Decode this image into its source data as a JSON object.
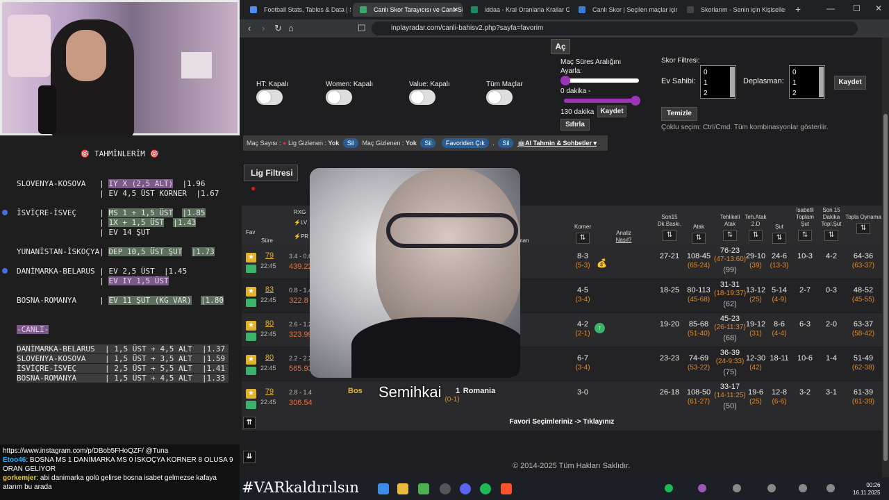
{
  "tabs": [
    {
      "label": "Football Stats, Tables & Data | Socc"
    },
    {
      "label": "Canlı Skor Tarayıcısı ve Canlı Si"
    },
    {
      "label": "iddaa - Kral Oranlarla Krallar Gibi K"
    },
    {
      "label": "Canlı Skor | Seçilen maçlar için canl"
    },
    {
      "label": "Skorlarım - Senin için Kişiselleştirilm"
    }
  ],
  "url": "inplayradar.com/canli-bahisv2.php?sayfa=favorim",
  "predictions": {
    "title": "TAHMİNLERİM",
    "lines": [
      {
        "text": "SLOVENYA-KOSOVA   |",
        "pick": "IY X (2,5 ALT)",
        "odd": "|1.96"
      },
      {
        "text": "                  |",
        "pick": "EV 4,5 ÜST KORNER",
        "odd": "|1.67"
      },
      {
        "text": "İSVİÇRE-İSVEÇ     |",
        "pick": "MS 1 + 1,5 ÜST",
        "odd": "|1.85"
      },
      {
        "text": "                  |",
        "pick": "1X + 1,5 ÜST",
        "odd": "|1.43"
      },
      {
        "text": "                  |",
        "pick": "EV 14 ŞUT",
        "odd": ""
      },
      {
        "text": "YUNANİSTAN-İSKOÇYA|",
        "pick": "DEP 10,5 ÜST ŞUT",
        "odd": "|1.73"
      },
      {
        "text": "DANİMARKA-BELARUS |",
        "pick": "EV 2,5 ÜST",
        "odd": "|1.45"
      },
      {
        "text": "                  |",
        "pick": "EV IY 1,5 ÜST",
        "odd": ""
      },
      {
        "text": "BOSNA-ROMANYA     |",
        "pick": "EV 11 ŞUT (KG VAR)",
        "odd": "|1.80"
      }
    ],
    "live_title": "-CANLI-",
    "live": [
      {
        "match": "DANİMARKA-BELARUS",
        "pick": "| 1,5 ÜST + 4,5 ALT",
        "odd": "|1.37"
      },
      {
        "match": "SLOVENYA-KOSOVA",
        "pick": "| 1,5 ÜST + 3,5 ALT",
        "odd": "|1.59"
      },
      {
        "match": "İSVİÇRE-İSVEÇ",
        "pick": "| 2,5 ÜST + 5,5 ALT",
        "odd": "|1.41"
      },
      {
        "match": "BOSNA-ROMANYA",
        "pick": "| 1,5 ÜST + 4,5 ALT",
        "odd": "|1.33"
      }
    ]
  },
  "chat": [
    {
      "user": "",
      "msg": "https://www.instagram.com/p/DBob5FHoQZF/ @Tuna"
    },
    {
      "user": "Etoo46",
      "msg": ": BOSNA MS 1 DANİMARKA MS 0 İSKOÇYA KORNER 8 OLUSA 9 ORAN GELİYOR"
    },
    {
      "user": "gorkemjer",
      "msg": ": abi danimarka golü gelirse bosna isabet gelmezse kafaya atarım bu arada"
    }
  ],
  "controls": {
    "ac": "Aç",
    "ht": "HT: Kapalı",
    "women": "Women: Kapalı",
    "value": "Value: Kapalı",
    "all": "Tüm Maçlar",
    "range_title": "Maç Süres Aralığını",
    "range_sub": "Ayarla:",
    "min": "0 dakika -",
    "max": "130 dakika",
    "save": "Kaydet",
    "reset": "Sıfırla",
    "score_filter": "Skor Filtresi:",
    "home": "Ev Sahibi:",
    "away": "Deplasman:",
    "list": [
      "0",
      "1",
      "2"
    ],
    "save2": "Kaydet",
    "clear": "Temizle",
    "hint": "Çoklu seçim: Ctrl/Cmd. Tüm kombinasyonlar gösterilir."
  },
  "bar": {
    "count": "Maç Sayısı :",
    "lig": "Lig Gizlenen :",
    "yok": "Yok",
    "sil": "Sil",
    "mac": "Maç Gizlenen :",
    "fav": "Favoriden Çık",
    "ai": "AI Tahmin & Sohbetler"
  },
  "lig_filter": "Lig Filtresi",
  "headers": {
    "fav": "Fav",
    "sure": "Süre",
    "rxg": "RXG",
    "lv": "LV",
    "pr": "PR",
    "man": "man",
    "korner": "Korner",
    "analiz": "Analiz",
    "nasil": "Nasıl?",
    "son15": "Son15 Dk.Baskı.",
    "atak": "Atak",
    "tehl": "Tehlikeli Atak",
    "teh": "Teh.Atak 2.D",
    "sut": "Şut",
    "isabet": "İsabetli Toplam Şut",
    "son15s": "Son 15 Dakika Topl.Şut",
    "topla": "Topla Oynama"
  },
  "rows": [
    {
      "min": "79",
      "time": "22:45",
      "rxg": "3.4 - 0.6",
      "val": "439.22",
      "korner": "8-3",
      "ksub": "(5-3)",
      "son15": "27-21",
      "atak": "108-45",
      "asub": "(65-24)",
      "tehl": "76-23",
      "tsub": "(47-13:60)",
      "tsub2": "(99)",
      "teh": "29-10",
      "tehsub": "(39)",
      "sut": "24-6",
      "sutsub": "(13-3)",
      "isabet": "10-3",
      "son15s": "4-2",
      "topla": "64-36",
      "tsub3": "(63-37)"
    },
    {
      "min": "83",
      "time": "22:45",
      "rxg": "0.8 - 1.4",
      "val": "322.8",
      "korner": "4-5",
      "ksub": "(3-4)",
      "son15": "18-25",
      "atak": "80-113",
      "asub": "(45-68)",
      "tehl": "31-31",
      "tsub": "(18-19:37)",
      "tsub2": "(62)",
      "teh": "13-12",
      "tehsub": "(25)",
      "sut": "5-14",
      "sutsub": "(4-9)",
      "isabet": "2-7",
      "son15s": "0-3",
      "topla": "48-52",
      "tsub3": "(45-55)"
    },
    {
      "min": "80",
      "time": "22:45",
      "rxg": "2.6 - 1.2",
      "val": "323.99",
      "korner": "4-2",
      "ksub": "(2-1)",
      "son15": "19-20",
      "atak": "85-68",
      "asub": "(51-40)",
      "tehl": "45-23",
      "tsub": "(26-11:37)",
      "tsub2": "(68)",
      "teh": "19-12",
      "tehsub": "(31)",
      "sut": "8-6",
      "sutsub": "(4-4)",
      "isabet": "6-3",
      "son15s": "2-0",
      "topla": "63-37",
      "tsub3": "(58-42)"
    },
    {
      "min": "80",
      "time": "22:45",
      "rxg": "2.2 - 2.2",
      "val": "565.93",
      "korner": "6-7",
      "ksub": "(3-4)",
      "son15": "23-23",
      "atak": "74-69",
      "asub": "(53-22)",
      "tehl": "36-39",
      "tsub": "(24-9:33)",
      "tsub2": "(75)",
      "teh": "12-30",
      "tehsub": "(42)",
      "sut": "18-11",
      "sutsub": "",
      "isabet": "10-6",
      "son15s": "1-4",
      "topla": "51-49",
      "tsub3": "(62-38)"
    },
    {
      "min": "79",
      "time": "22:45",
      "rxg": "2.8 - 1.4",
      "val": "306.54",
      "korner": "3-0",
      "ksub": "",
      "son15": "26-18",
      "atak": "108-50",
      "asub": "(61-27)",
      "tehl": "33-17",
      "tsub": "(14-11:25)",
      "tsub2": "(50)",
      "teh": "19-6",
      "tehsub": "(25)",
      "sut": "12-8",
      "sutsub": "(6-6)",
      "isabet": "3-2",
      "son15s": "3-1",
      "topla": "61-39",
      "tsub3": "(61-39)"
    }
  ],
  "row5": {
    "home": "Bos",
    "score": "1",
    "away": "Romania",
    "half": "(0-1)"
  },
  "footer": "Favori Seçimleriniz -> Tıklayınız",
  "copyright": "© 2014-2025 Tüm Hakları Saklıdır.",
  "overlay_name": "Semihkai",
  "hashtag": "#VARkaldırılsın",
  "clock": {
    "time": "00:26",
    "date": "16.11.2025"
  }
}
